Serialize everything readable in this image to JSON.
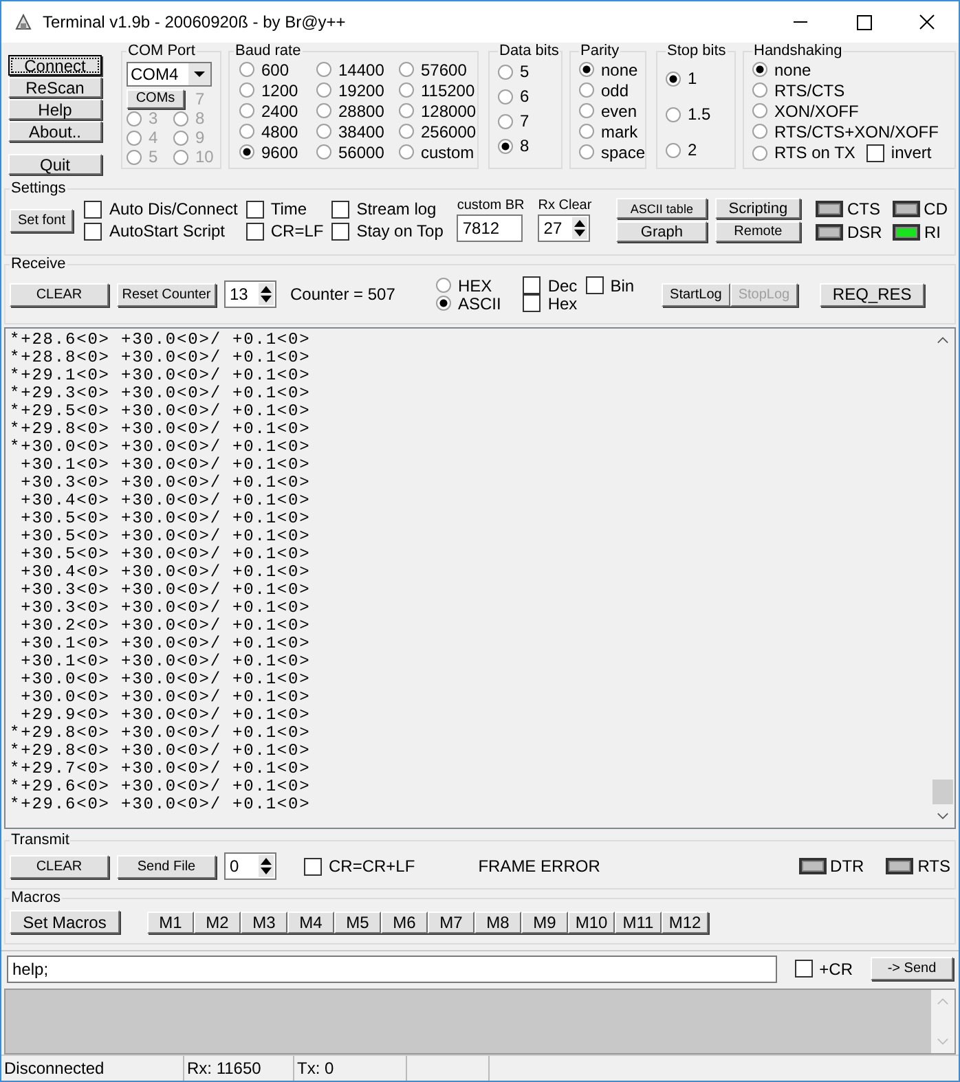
{
  "window": {
    "title": "Terminal v1.9b - 20060920ß - by Br@y++"
  },
  "side_buttons": [
    {
      "label": "Connect",
      "focused": true
    },
    {
      "label": "ReScan",
      "focused": false
    },
    {
      "label": "Help",
      "focused": false
    },
    {
      "label": "About..",
      "focused": false
    },
    {
      "label": "Quit",
      "focused": false
    }
  ],
  "com_port": {
    "title": "COM Port",
    "value": "COM4",
    "button": "COMs",
    "ports": [
      {
        "label": "7",
        "disabled": true
      },
      {
        "label": "3",
        "disabled": true,
        "selected": false
      },
      {
        "label": "8",
        "disabled": true,
        "selected": false
      },
      {
        "label": "4",
        "disabled": true,
        "selected": false
      },
      {
        "label": "9",
        "disabled": true,
        "selected": false
      },
      {
        "label": "5",
        "disabled": true,
        "selected": false
      },
      {
        "label": "10",
        "disabled": true,
        "selected": false
      }
    ]
  },
  "baud_rate": {
    "title": "Baud rate",
    "options": [
      {
        "label": "600",
        "selected": false
      },
      {
        "label": "1200",
        "selected": false
      },
      {
        "label": "2400",
        "selected": false
      },
      {
        "label": "4800",
        "selected": false
      },
      {
        "label": "9600",
        "selected": true
      },
      {
        "label": "14400",
        "selected": false
      },
      {
        "label": "19200",
        "selected": false
      },
      {
        "label": "28800",
        "selected": false
      },
      {
        "label": "38400",
        "selected": false
      },
      {
        "label": "56000",
        "selected": false
      },
      {
        "label": "57600",
        "selected": false
      },
      {
        "label": "115200",
        "selected": false
      },
      {
        "label": "128000",
        "selected": false
      },
      {
        "label": "256000",
        "selected": false
      },
      {
        "label": "custom",
        "selected": false
      }
    ]
  },
  "data_bits": {
    "title": "Data bits",
    "options": [
      {
        "label": "5",
        "selected": false
      },
      {
        "label": "6",
        "selected": false
      },
      {
        "label": "7",
        "selected": false
      },
      {
        "label": "8",
        "selected": true
      }
    ]
  },
  "parity": {
    "title": "Parity",
    "options": [
      {
        "label": "none",
        "selected": true
      },
      {
        "label": "odd",
        "selected": false
      },
      {
        "label": "even",
        "selected": false
      },
      {
        "label": "mark",
        "selected": false
      },
      {
        "label": "space",
        "selected": false
      }
    ]
  },
  "stop_bits": {
    "title": "Stop bits",
    "options": [
      {
        "label": "1",
        "selected": true
      },
      {
        "label": "1.5",
        "selected": false
      },
      {
        "label": "2",
        "selected": false
      }
    ]
  },
  "handshaking": {
    "title": "Handshaking",
    "options": [
      {
        "label": "none",
        "selected": true
      },
      {
        "label": "RTS/CTS",
        "selected": false
      },
      {
        "label": "XON/XOFF",
        "selected": false
      },
      {
        "label": "RTS/CTS+XON/XOFF",
        "selected": false
      },
      {
        "label": "RTS on TX",
        "selected": false
      }
    ],
    "invert": {
      "label": "invert",
      "checked": false
    }
  },
  "settings": {
    "title": "Settings",
    "set_font": "Set font",
    "checkboxes": [
      {
        "label": "Auto Dis/Connect",
        "checked": false
      },
      {
        "label": "AutoStart Script",
        "checked": false
      },
      {
        "label": "Time",
        "checked": false
      },
      {
        "label": "CR=LF",
        "checked": false
      },
      {
        "label": "Stream log",
        "checked": false
      },
      {
        "label": "Stay on Top",
        "checked": false
      }
    ],
    "custom_br": {
      "label": "custom BR",
      "value": "7812"
    },
    "rx_clear": {
      "label": "Rx Clear",
      "value": "27"
    },
    "buttons": [
      "ASCII table",
      "Scripting",
      "Graph",
      "Remote"
    ],
    "leds": [
      {
        "label": "CTS",
        "on": false
      },
      {
        "label": "CD",
        "on": false
      },
      {
        "label": "DSR",
        "on": false
      },
      {
        "label": "RI",
        "on": true
      }
    ]
  },
  "receive": {
    "title": "Receive",
    "clear": "CLEAR",
    "reset": "Reset Counter",
    "spin": "13",
    "counter": "Counter =  507",
    "modes": [
      {
        "label": "HEX",
        "selected": false
      },
      {
        "label": "ASCII",
        "selected": true
      }
    ],
    "checkboxes": [
      {
        "label": "Dec",
        "checked": false
      },
      {
        "label": "Hex",
        "checked": false
      },
      {
        "label": "Bin",
        "checked": false
      }
    ],
    "buttons": [
      {
        "label": "StartLog",
        "disabled": false
      },
      {
        "label": "StopLog",
        "disabled": true
      }
    ],
    "req": "REQ_RES"
  },
  "log_lines": [
    "*+28.6<0> +30.0<0>/ +0.1<0>",
    "*+28.8<0> +30.0<0>/ +0.1<0>",
    "*+29.1<0> +30.0<0>/ +0.1<0>",
    "*+29.3<0> +30.0<0>/ +0.1<0>",
    "*+29.5<0> +30.0<0>/ +0.1<0>",
    "*+29.8<0> +30.0<0>/ +0.1<0>",
    "*+30.0<0> +30.0<0>/ +0.1<0>",
    " +30.1<0> +30.0<0>/ +0.1<0>",
    " +30.3<0> +30.0<0>/ +0.1<0>",
    " +30.4<0> +30.0<0>/ +0.1<0>",
    " +30.5<0> +30.0<0>/ +0.1<0>",
    " +30.5<0> +30.0<0>/ +0.1<0>",
    " +30.5<0> +30.0<0>/ +0.1<0>",
    " +30.4<0> +30.0<0>/ +0.1<0>",
    " +30.3<0> +30.0<0>/ +0.1<0>",
    " +30.3<0> +30.0<0>/ +0.1<0>",
    " +30.2<0> +30.0<0>/ +0.1<0>",
    " +30.1<0> +30.0<0>/ +0.1<0>",
    " +30.1<0> +30.0<0>/ +0.1<0>",
    " +30.0<0> +30.0<0>/ +0.1<0>",
    " +30.0<0> +30.0<0>/ +0.1<0>",
    " +29.9<0> +30.0<0>/ +0.1<0>",
    "*+29.8<0> +30.0<0>/ +0.1<0>",
    "*+29.8<0> +30.0<0>/ +0.1<0>",
    "*+29.7<0> +30.0<0>/ +0.1<0>",
    "*+29.6<0> +30.0<0>/ +0.1<0>",
    "*+29.6<0> +30.0<0>/ +0.1<0>"
  ],
  "transmit": {
    "title": "Transmit",
    "clear": "CLEAR",
    "send_file": "Send File",
    "spin": "0",
    "checkbox": {
      "label": "CR=CR+LF",
      "checked": false
    },
    "status": "FRAME ERROR",
    "leds": [
      {
        "label": "DTR",
        "on": false
      },
      {
        "label": "RTS",
        "on": false
      }
    ]
  },
  "macros": {
    "title": "Macros",
    "set": "Set Macros",
    "buttons": [
      "M1",
      "M2",
      "M3",
      "M4",
      "M5",
      "M6",
      "M7",
      "M8",
      "M9",
      "M10",
      "M11",
      "M12"
    ]
  },
  "send": {
    "value": "help;",
    "checkbox": {
      "label": "+CR",
      "checked": false
    },
    "button": "-> Send"
  },
  "status_bar": [
    "Disconnected",
    "Rx: 11650",
    "Tx: 0"
  ]
}
